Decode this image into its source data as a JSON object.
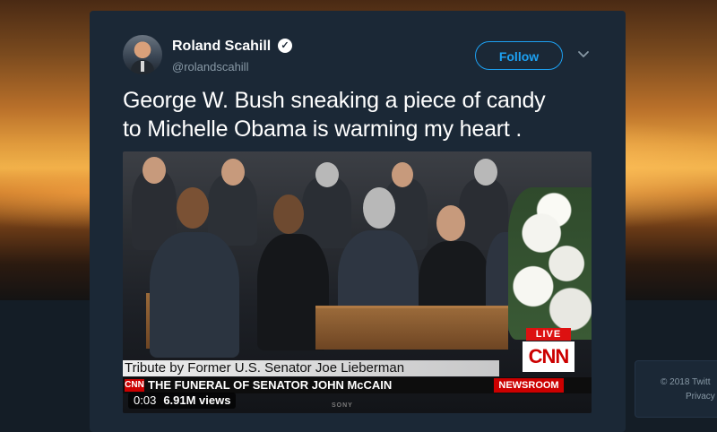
{
  "tweet": {
    "author_name": "Roland Scahill",
    "author_handle": "@rolandscahill",
    "follow_label": "Follow",
    "text_line1": "George W. Bush sneaking a piece of candy",
    "text_line2": "to Michelle Obama is warming my heart ."
  },
  "video": {
    "lower_third": "Tribute by Former U.S. Senator Joe Lieberman",
    "ticker_logo": "CNN",
    "ticker_text": "THE FUNERAL OF SENATOR JOHN McCAIN",
    "live_label": "LIVE",
    "network_logo": "CNN",
    "segment_label": "NEWSROOM",
    "tv_brand": "SONY",
    "duration": "0:03",
    "views": "6.91M views"
  },
  "sidebar": {
    "copyright": "© 2018 Twitt",
    "privacy": "Privacy"
  },
  "icons": {
    "verified": "verified-badge-icon",
    "caret": "chevron-down-icon"
  },
  "colors": {
    "accent": "#1da1f2",
    "card_bg": "#1b2836",
    "page_bg": "#141d26",
    "muted_text": "#8899a6",
    "live_red": "#dd1111"
  }
}
